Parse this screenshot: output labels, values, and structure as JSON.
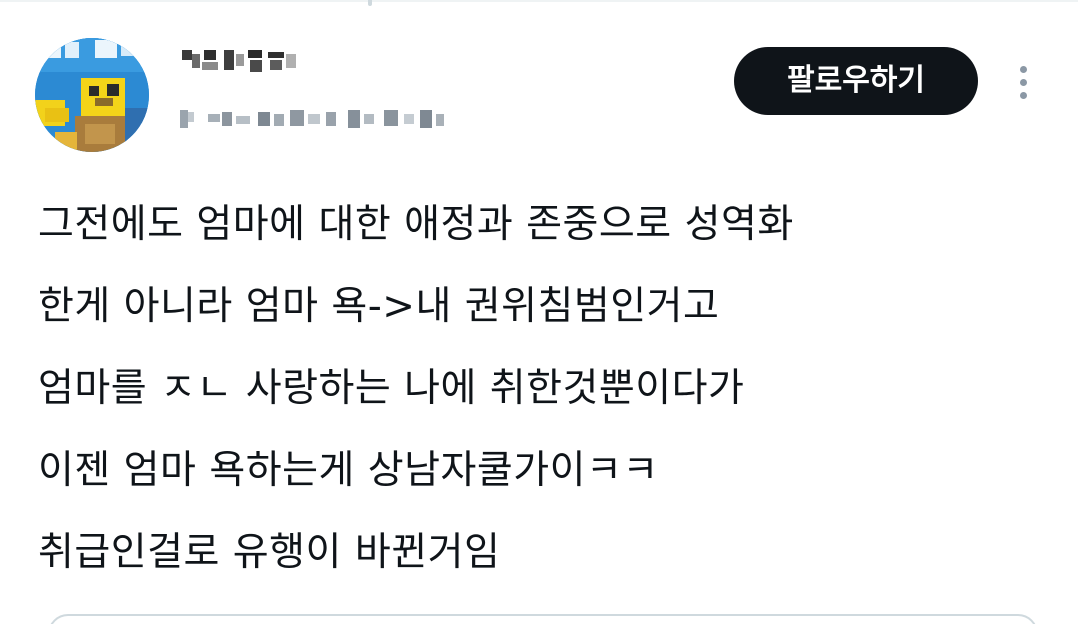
{
  "tweet": {
    "author": {
      "avatar_icon": "user-avatar-icon"
    },
    "follow_label": "팔로우하기",
    "more_icon": "more-options-icon",
    "lines": [
      "그전에도 엄마에 대한 애정과 존중으로 성역화",
      "한게 아니라 엄마 욕->내 권위침범인거고",
      "엄마를 ㅈㄴ 사랑하는 나에 취한것뿐이다가",
      "이젠 엄마 욕하는게 상남자쿨가이ㅋㅋ",
      "취급인걸로 유행이 바뀐거임"
    ]
  },
  "colors": {
    "button_bg": "#0f1419",
    "button_text": "#ffffff",
    "text": "#0f1419",
    "more_icon": "#8b98a5",
    "divider": "#eff3f4"
  }
}
